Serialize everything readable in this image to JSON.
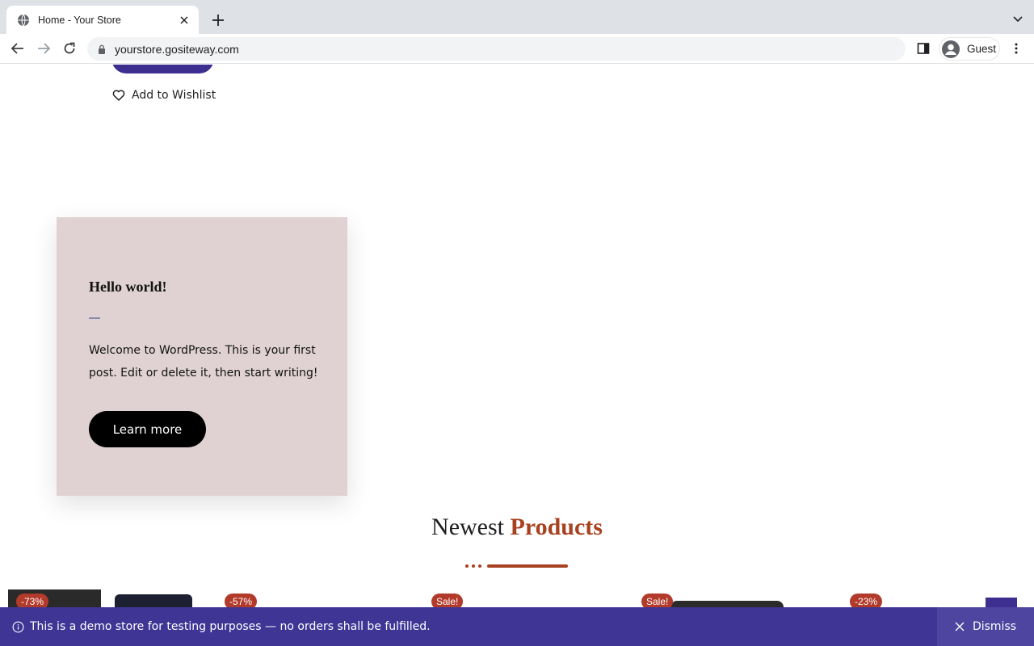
{
  "browser": {
    "tab_title": "Home - Your Store",
    "url": "yourstore.gositeway.com",
    "profile_name": "Guest"
  },
  "page": {
    "wishlist_label": "Add to Wishlist",
    "post": {
      "title": "Hello world!",
      "excerpt": "Welcome to WordPress. This is your first post. Edit or delete it, then start writing!",
      "button_label": "Learn more"
    },
    "section_heading": {
      "word1": "Newest",
      "word2": "Products"
    },
    "products": [
      {
        "badge": "-73%"
      },
      {
        "badge": "-57%"
      },
      {
        "badge": "Sale!"
      },
      {
        "badge": "Sale!"
      },
      {
        "badge": "-23%"
      }
    ],
    "colors": {
      "brand_purple": "#3d2f8f",
      "accent_rust": "#a8411f",
      "card_bg": "#e0d2d2",
      "badge_red": "#b23a2a"
    }
  },
  "notice": {
    "message": "This is a demo store for testing purposes — no orders shall be fulfilled.",
    "dismiss_label": "Dismiss"
  },
  "icons": [
    "globe-icon",
    "close-icon",
    "plus-icon",
    "chevron-down-icon",
    "back-icon",
    "forward-icon",
    "reload-icon",
    "lock-icon",
    "side-panel-icon",
    "profile-icon",
    "kebab-menu-icon",
    "heart-icon",
    "info-icon",
    "x-icon"
  ]
}
